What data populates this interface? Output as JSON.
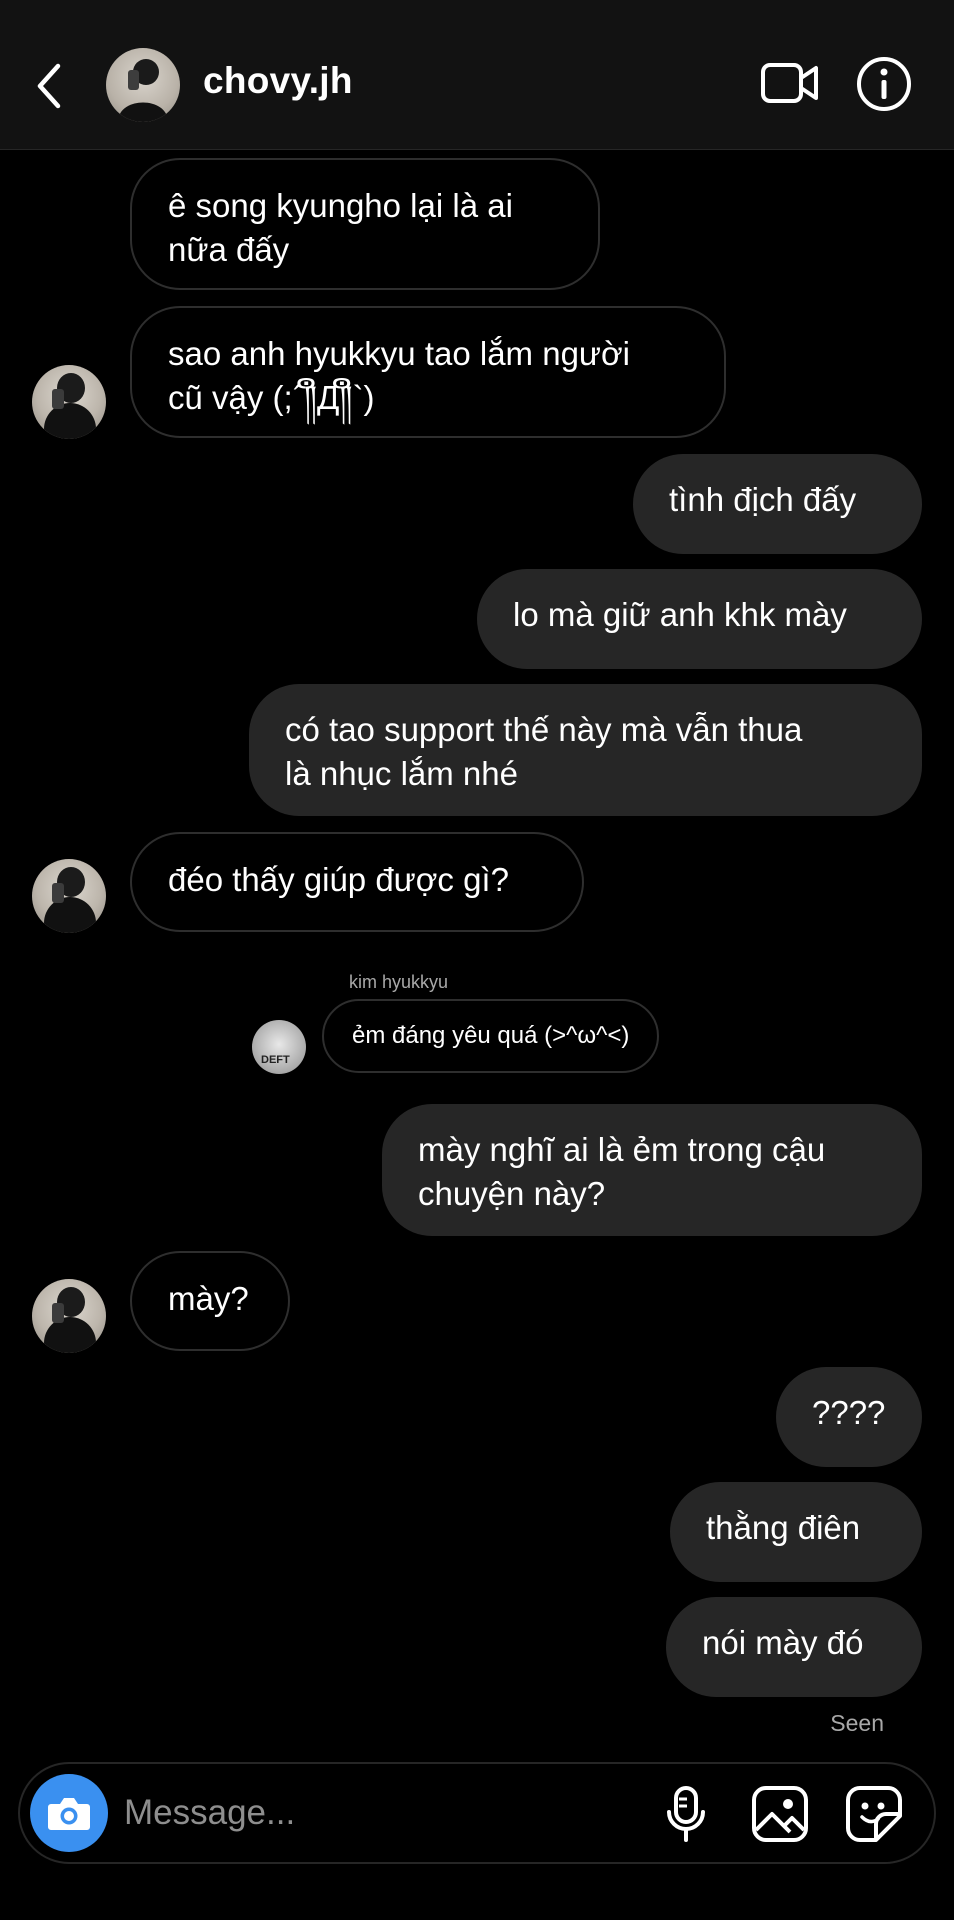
{
  "header": {
    "username": "chovy.jh"
  },
  "messages": [
    {
      "side": "in",
      "text": "ê song kyungho lại là ai\nnữa đấy"
    },
    {
      "side": "in",
      "text": "sao anh hyukkyu tao lắm người\ncũ vậy (;´༎ຶД༎ຶ`)"
    },
    {
      "side": "out",
      "text": "tình địch đấy"
    },
    {
      "side": "out",
      "text": "lo mà giữ anh khk mày"
    },
    {
      "side": "out",
      "text": "có tao support thế này mà vẫn thua\nlà nhục lắm nhé"
    },
    {
      "side": "in",
      "text": "đéo thấy giúp được gì?"
    },
    {
      "side": "out",
      "text": "mày nghĩ ai là ẻm trong cậu\nchuyện này?"
    },
    {
      "side": "in",
      "text": "mày?"
    },
    {
      "side": "out",
      "text": "????"
    },
    {
      "side": "out",
      "text": "thằng điên"
    },
    {
      "side": "out",
      "text": "nói mày đó"
    }
  ],
  "reply": {
    "name": "kim hyukkyu",
    "text": "ẻm đáng yêu quá (>^ω^<)",
    "avatar_text": "DEFT"
  },
  "status": {
    "seen": "Seen"
  },
  "composer": {
    "placeholder": "Message..."
  },
  "colors": {
    "background": "#000000",
    "outgoing_bubble": "#262626",
    "camera_button": "#3a90f0"
  }
}
